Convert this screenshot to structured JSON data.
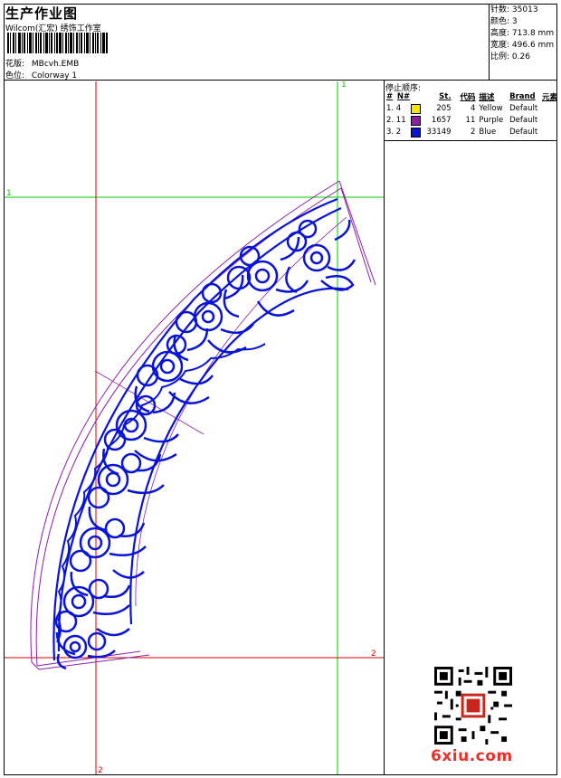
{
  "header": {
    "title": "生产作业图",
    "company": "Wilcom(汇宏) 绣饰工作室"
  },
  "design_info": {
    "file_label": "花版:",
    "file_value": "MBcvh.EMB",
    "colorway_label": "色位:",
    "colorway_value": "Colorway 1"
  },
  "stats": [
    {
      "label": "针数:",
      "value": "35013"
    },
    {
      "label": "颜色:",
      "value": "3"
    },
    {
      "label": "高度:",
      "value": "713.8 mm"
    },
    {
      "label": "宽度:",
      "value": "496.6 mm"
    },
    {
      "label": "比例:",
      "value": "0.26"
    }
  ],
  "color_sequence": {
    "title": "停止顺序:",
    "headers": [
      "#",
      "N#",
      "St.",
      "代码",
      "描述",
      "Brand",
      "元素"
    ],
    "rows": [
      {
        "order": "1. 4",
        "color": "#f7e600",
        "stitches": "205",
        "code": "4",
        "description": "Yellow",
        "brand": "Default"
      },
      {
        "order": "2. 11",
        "color": "#8b1fa8",
        "stitches": "1657",
        "code": "11",
        "description": "Purple",
        "brand": "Default"
      },
      {
        "order": "3. 2",
        "color": "#0a14d6",
        "stitches": "33149",
        "code": "2",
        "description": "Blue",
        "brand": "Default"
      }
    ]
  },
  "guides": {
    "top_label": "1",
    "left_label": "1",
    "right_label": "2",
    "bottom_label": "2"
  },
  "colors": {
    "guide_green": "#00cc00",
    "guide_red": "#e00000",
    "embroidery_blue": "#0a14d6",
    "outline_purple": "#8b1fa8",
    "brand_red": "#e8312a"
  },
  "watermark": {
    "qr_icon": "qr-code-icon",
    "brand_text": "6xiu.com"
  }
}
